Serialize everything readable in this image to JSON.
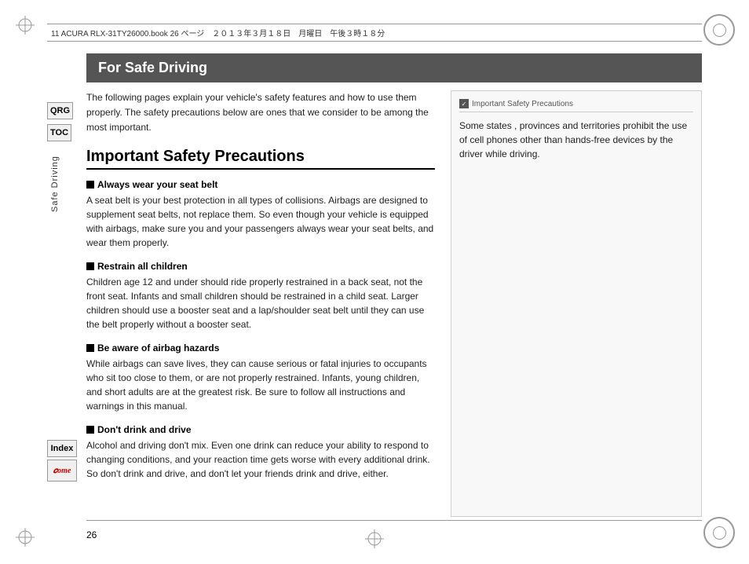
{
  "page": {
    "number": "26",
    "top_meta": "11 ACURA RLX-31TY26000.book  26 ページ　２０１３年３月１８日　月曜日　午後３時１８分"
  },
  "sidebar": {
    "qrg_label": "QRG",
    "toc_label": "TOC",
    "safe_driving_label": "Safe Driving",
    "index_label": "Index",
    "home_label": "Home"
  },
  "header": {
    "title": "For Safe Driving"
  },
  "intro": {
    "text": "The following pages explain your vehicle's safety features and how to use them properly. The safety precautions below are ones that we consider to be among the most important."
  },
  "section": {
    "title": "Important Safety Precautions",
    "subsections": [
      {
        "id": "seat-belt",
        "header": "Always wear your seat belt",
        "body": "A seat belt is your best protection in all types of collisions. Airbags are designed to supplement seat belts, not replace them. So even though your vehicle is equipped with airbags, make sure you and your passengers always wear your seat belts, and wear them properly."
      },
      {
        "id": "children",
        "header": "Restrain all children",
        "body": "Children age 12 and under should ride properly restrained in a back seat, not the front seat. Infants and small children should be restrained in a child seat. Larger children should use a booster seat and a lap/shoulder seat belt until they can use the belt properly without a booster seat."
      },
      {
        "id": "airbag",
        "header": "Be aware of airbag hazards",
        "body": "While airbags can save lives, they can cause serious or fatal injuries to occupants who sit too close to them, or are not properly restrained. Infants, young children, and short adults are at the greatest risk. Be sure to follow all instructions and warnings in this manual."
      },
      {
        "id": "drink-drive",
        "header": "Don't drink and drive",
        "body": "Alcohol and driving don't mix. Even one drink can reduce your ability to respond to changing conditions, and your reaction time gets worse with every additional drink. So don't drink and drive, and don't let your friends drink and drive, either."
      }
    ]
  },
  "right_panel": {
    "header": "Important Safety Precautions",
    "body": "Some states , provinces and territories prohibit the use of cell phones other than hands-free devices by the driver while driving."
  }
}
